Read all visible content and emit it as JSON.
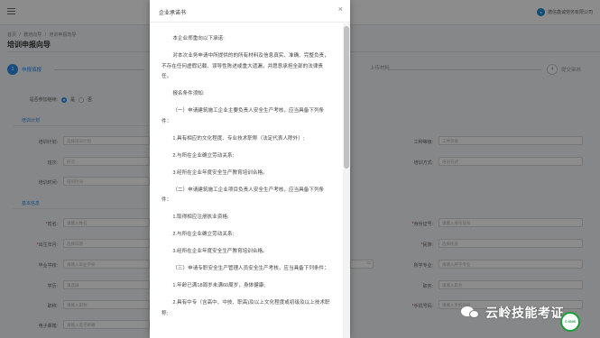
{
  "header": {
    "company_name": "德信鑫诚劳务有限公司"
  },
  "breadcrumb": [
    "首页",
    "/",
    "教培向导",
    "/",
    "培训申报向导"
  ],
  "page_title": "培训申报向导",
  "steps": [
    {
      "number": "1",
      "label": "申报填报",
      "active": true
    },
    {
      "number": "",
      "label": "",
      "active": false
    },
    {
      "number": "",
      "label": "上传材料",
      "active": false
    },
    {
      "number": "4",
      "label": "提交审核",
      "active": false
    }
  ],
  "form": {
    "continuing_edu_label": "是否参加继续:",
    "continuing_edu_yes": "是",
    "continuing_edu_no": "否",
    "section_training_plan": "培训计划",
    "section_basic_info": "基本信息",
    "training_plan_label": "培训计划:",
    "training_plan_placeholder": "选择培训计划",
    "class_label": "班次:",
    "class_placeholder": "班次",
    "training_time_label": "培训时间:",
    "training_time_placeholder": "培训时间",
    "job_type_label": "工种等级:",
    "job_type_placeholder": "工种等级",
    "training_method_label": "培训方式:",
    "training_method_placeholder": "培训方式",
    "name_label": "姓名:",
    "name_placeholder": "请输入姓名",
    "birth_label": "出生年月:",
    "birth_placeholder": "选择日期",
    "school_label": "毕业学校:",
    "school_placeholder": "请输入毕业学校",
    "education_label": "学历:",
    "education_placeholder": "请选择",
    "title_label": "职称:",
    "title_placeholder": "请输入职称",
    "email_label": "电子邮箱:",
    "email_placeholder": "请输入电子邮箱",
    "id_label": "身份证号:",
    "id_placeholder": "请输入身份证号",
    "ethnicity_label": "民族:",
    "ethnicity_placeholder": "选择民族",
    "major_label": "所学专业:",
    "major_placeholder": "请输入所学专业",
    "position_label": "职务:",
    "position_placeholder": "请输入职务",
    "phone_label": "手机号码:",
    "phone_placeholder": "请输入手机号码"
  },
  "modal": {
    "title": "企业承诺书",
    "close_icon": "close-icon",
    "paragraphs": [
      {
        "text": "本企业郑重向以下承诺:",
        "style": "indent"
      },
      {
        "text": "对本次业务申请中所提供的的所有材料及信息真实、准确、完整负责，不存在任何虚假记载、误导性陈述或重大遗漏，并愿意承担全部的法律责任。",
        "style": "indent"
      },
      {
        "text": "报名条件须知:",
        "style": "indent"
      },
      {
        "text": "（一）申请建筑施工企业主要负责人安全生产考核，应当具备下列条件：",
        "style": "sub"
      },
      {
        "text": "1.具有相应的文化程度、专业技术职称（法定代表人除外）;",
        "style": "sub"
      },
      {
        "text": "2.与所在企业确立劳动关系;",
        "style": "sub"
      },
      {
        "text": "3.经所在企业年度安全生产教育培训合格。",
        "style": "sub"
      },
      {
        "text": "（二）申请建筑施工企业项目负责人安全生产考核，应当具备下列条件：",
        "style": "sub"
      },
      {
        "text": "1.取得相应注册执业资格;",
        "style": "sub"
      },
      {
        "text": "2.与所在企业确立劳动关系;",
        "style": "sub"
      },
      {
        "text": "3.经所在企业年度安全生产教育培训合格。",
        "style": "sub"
      },
      {
        "text": "（三）申请专职安全生产管理人员安全生产考核，应当具备下列条件：",
        "style": "sub"
      },
      {
        "text": "1.年龄已满18周岁未满60周岁，身体健康;",
        "style": "sub"
      },
      {
        "text": "2.具有中专（含高中、中技、职高)及以上文化程度或初级及以上技术职称;",
        "style": "sub"
      }
    ]
  },
  "watermark": {
    "text": "云岭技能考证",
    "badge": "C KNIS"
  },
  "colors": {
    "accent": "#2d8cf0",
    "required": "#e33333",
    "overlay": "rgba(0,0,0,0.45)"
  }
}
